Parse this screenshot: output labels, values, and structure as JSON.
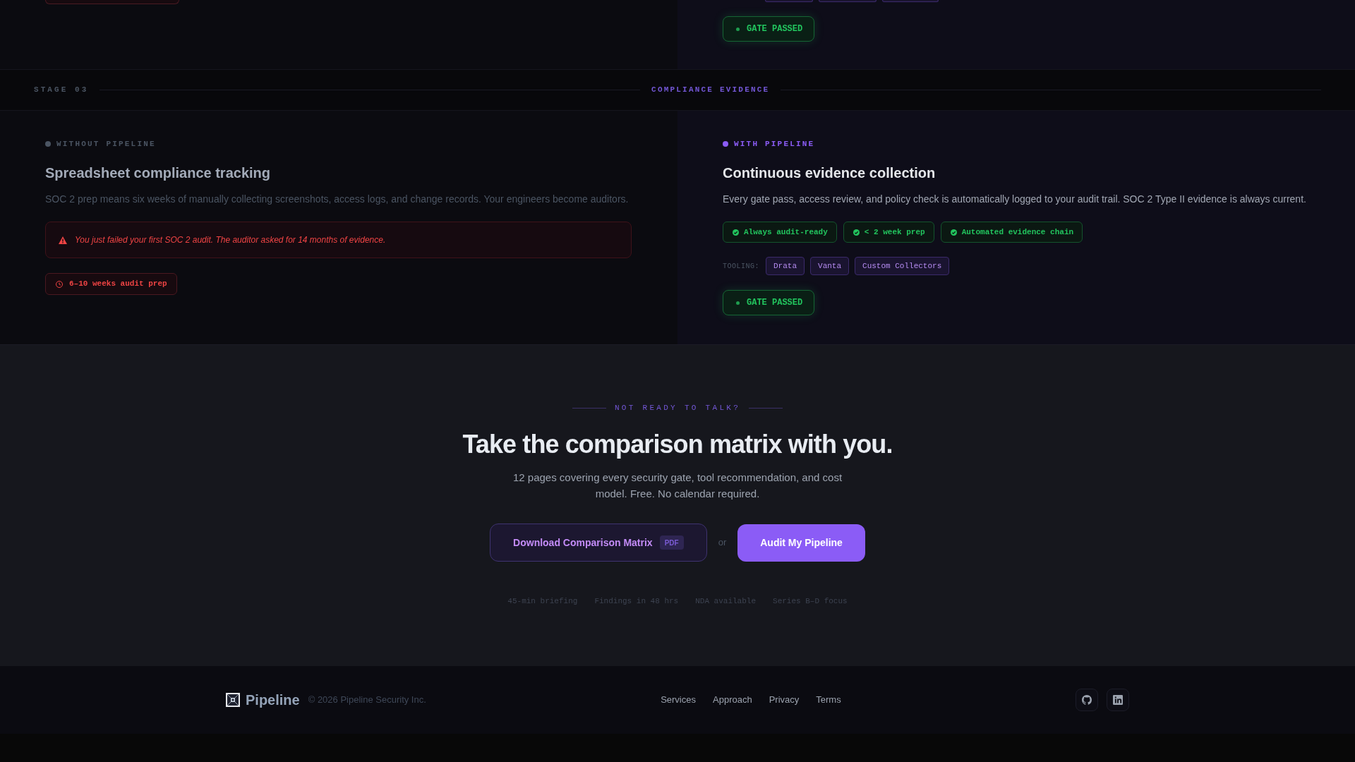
{
  "previous_stage": {
    "gate": {
      "label": "GATE PASSED",
      "passed": true
    }
  },
  "stage": {
    "label": "STAGE 03",
    "title": "COMPLIANCE EVIDENCE"
  },
  "comparison": [
    {
      "kind": "without",
      "eyebrow": "WITHOUT PIPELINE",
      "heading": "Spreadsheet compliance tracking",
      "body": "SOC 2 prep means six weeks of manually collecting screenshots, access logs, and change records. Your engineers become auditors.",
      "alert": "You just failed your first SOC 2 audit. The auditor asked for 14 months of evidence.",
      "badges": [
        {
          "kind": "time",
          "label": "6–10 weeks audit prep"
        }
      ]
    },
    {
      "kind": "with",
      "eyebrow": "WITH PIPELINE",
      "heading": "Continuous evidence collection",
      "body": "Every gate pass, access review, and policy check is automatically logged to your audit trail. SOC 2 Type II evidence is always current.",
      "badges": [
        {
          "kind": "check",
          "label": "Always audit-ready"
        },
        {
          "kind": "check",
          "label": "< 2 week prep"
        },
        {
          "kind": "check",
          "label": "Automated evidence chain"
        }
      ],
      "tooling": {
        "label": "TOOLING:",
        "tools": [
          "Drata",
          "Vanta",
          "Custom Collectors"
        ]
      },
      "gate": {
        "label": "GATE PASSED",
        "passed": true
      }
    }
  ],
  "cta": {
    "eyebrow": "NOT READY TO TALK?",
    "heading": "Take the comparison matrix with you.",
    "subtitle": "12 pages covering every security gate, tool recommendation, and cost model. Free. No calendar required.",
    "actions": [
      {
        "kind": "secondary",
        "label": "Download Comparison Matrix",
        "tag": "PDF"
      },
      {
        "kind": "separator",
        "label": "or"
      },
      {
        "kind": "primary",
        "label": "Audit My Pipeline"
      }
    ],
    "facts": [
      "45-min briefing",
      "Findings in 48 hrs",
      "NDA available",
      "Series B–D focus"
    ]
  },
  "footer": {
    "brand": "Pipeline",
    "copyright": "© 2026 Pipeline Security Inc.",
    "links": [
      "Services",
      "Approach",
      "Privacy",
      "Terms"
    ]
  }
}
